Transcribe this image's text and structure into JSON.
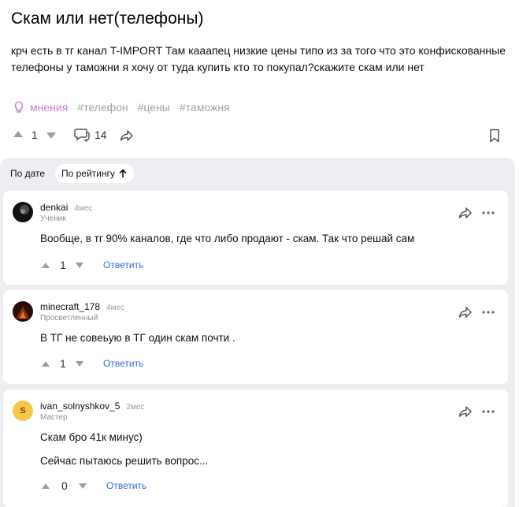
{
  "question": {
    "title": "Скам или нет(телефоны)",
    "body": "крч есть в тг канал T-IMPORT Там кааапец низкие цены типо из за того что это конфискованные телефоны у таможни я хочу от туда купить кто то покупал?скажите скам или нет",
    "tags": [
      "мнения",
      "#телефон",
      "#цены",
      "#таможня"
    ],
    "votes": "1",
    "comments_count": "14"
  },
  "colors": {
    "accent_tag": "#c77fe0",
    "link": "#2f6fdb",
    "panel_bg": "#eceef2",
    "avatar_ivan": "#f5c84c"
  },
  "sort": {
    "by_date": "По дате",
    "by_rating": "По рейтингу"
  },
  "comments": [
    {
      "user": "denkai",
      "time": "4мес",
      "rank": "Ученик",
      "lines": [
        "Вообще, в тг 90% каналов, где что либо продают - скам. Так что решай сам"
      ],
      "votes": "1",
      "reply": "Ответить"
    },
    {
      "user": "minecraft_178",
      "time": "4мес",
      "rank": "Просветленный",
      "lines": [
        "В ТГ не совеьую в ТГ один скам почти ."
      ],
      "votes": "1",
      "reply": "Ответить"
    },
    {
      "user": "ivan_solnyshkov_5",
      "time": "2мес",
      "rank": "Мастер",
      "avatar_letter": "S",
      "lines": [
        "Скам бро 41к минус)",
        "Сейчас пытаюсь решить вопрос..."
      ],
      "votes": "0",
      "reply": "Ответить"
    }
  ]
}
